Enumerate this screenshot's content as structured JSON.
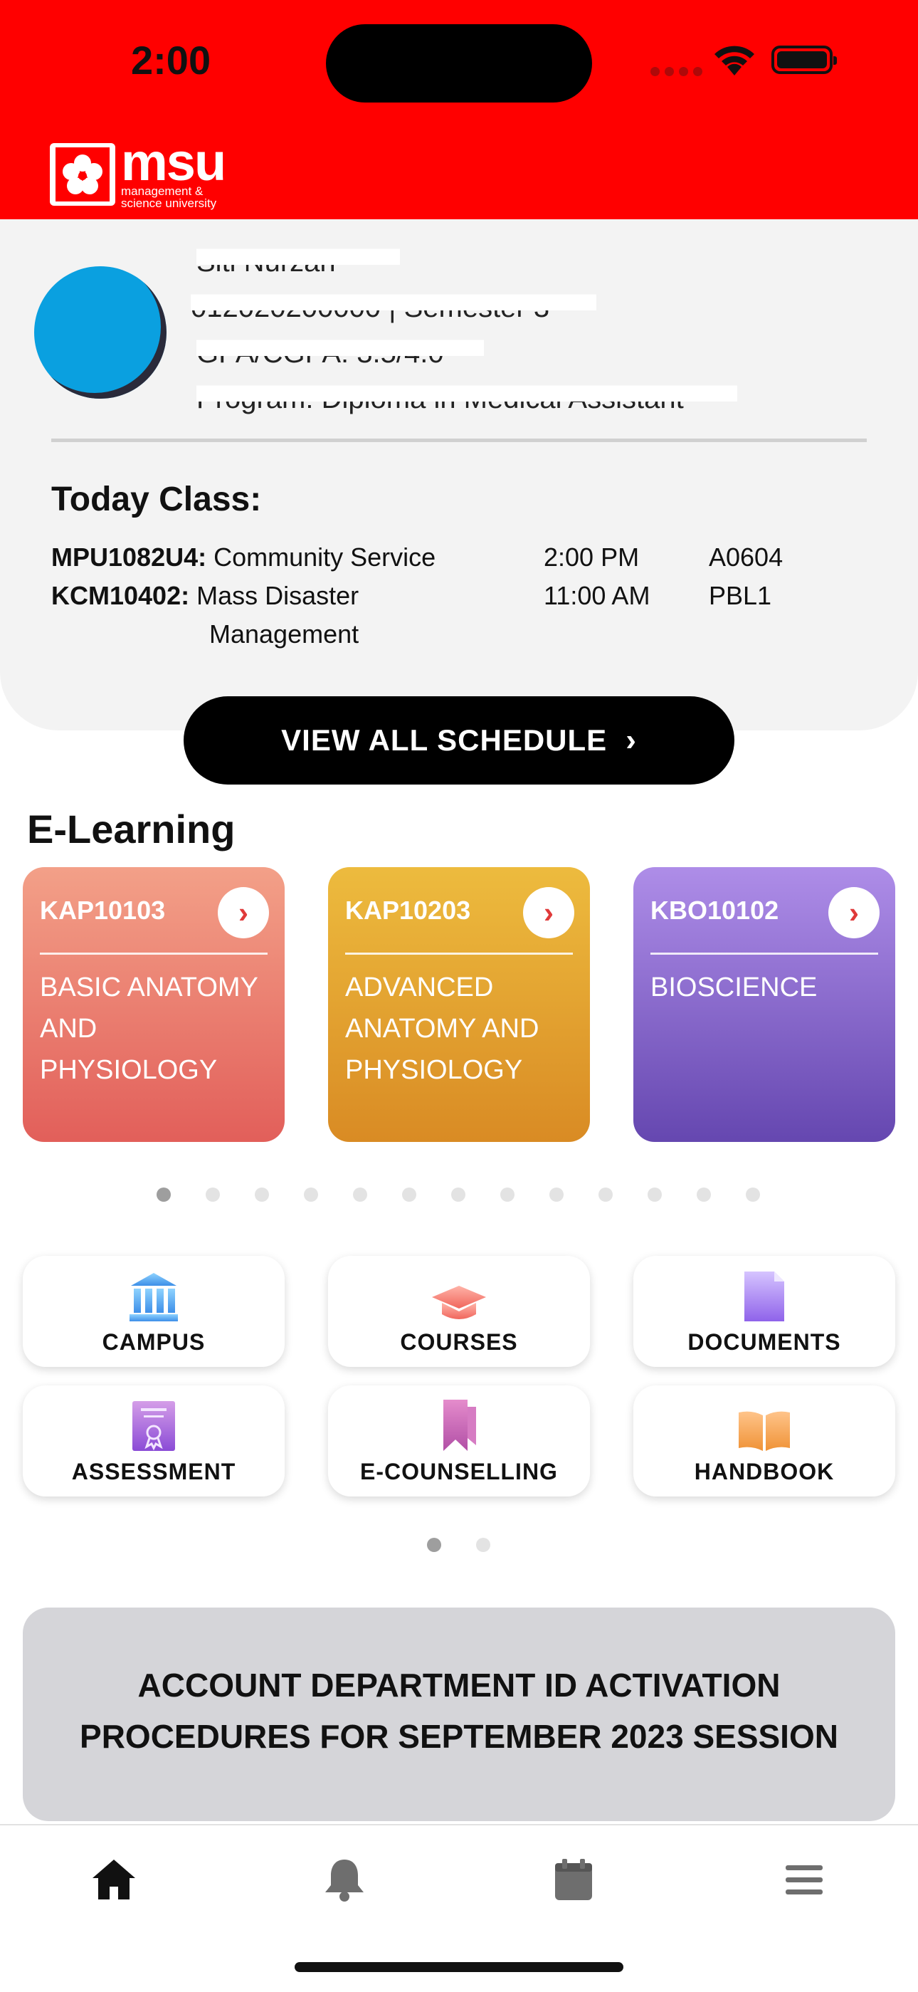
{
  "status_bar": {
    "time": "2:00"
  },
  "header": {
    "logo_name": "msu",
    "logo_sub_1": "management &",
    "logo_sub_2": "science university"
  },
  "profile": {
    "name": "Siti Nurzah",
    "id_semester": "012020200000 | Semester 3",
    "gpa_cgpa": "GPA/CGPA: 3.5/4.0",
    "program": "Program: Diploma in Medical Assistant"
  },
  "today_class": {
    "title": "Today Class:",
    "rows": [
      {
        "code": "MPU1082U4:",
        "subject": "Community Service",
        "time": "2:00 PM",
        "room": "A0604"
      },
      {
        "code": "KCM10402:",
        "subject_line1": "Mass Disaster",
        "subject_line2": "Management",
        "time": "11:00 AM",
        "room": "PBL1"
      }
    ]
  },
  "view_all": {
    "label": "VIEW ALL SCHEDULE"
  },
  "elearning": {
    "title": "E-Learning",
    "courses": [
      {
        "code": "KAP10103",
        "name_1": "BASIC ANATOMY",
        "name_2": "AND",
        "name_3": "PHYSIOLOGY"
      },
      {
        "code": "KAP10203",
        "name_1": "ADVANCED",
        "name_2": "ANATOMY AND",
        "name_3": "PHYSIOLOGY"
      },
      {
        "code": "KBO10102",
        "name_1": "BIOSCIENCE"
      }
    ],
    "page_count": 13,
    "active_page": 1
  },
  "quick_menu": {
    "items": [
      {
        "label": "CAMPUS",
        "icon": "campus-icon"
      },
      {
        "label": "COURSES",
        "icon": "graduation-cap-icon"
      },
      {
        "label": "DOCUMENTS",
        "icon": "document-icon"
      },
      {
        "label": "ASSESSMENT",
        "icon": "certificate-icon"
      },
      {
        "label": "E-COUNSELLING",
        "icon": "bookmark-icon"
      },
      {
        "label": "HANDBOOK",
        "icon": "open-book-icon"
      }
    ],
    "page_count": 2,
    "active_page": 1
  },
  "announcement": {
    "line1": "ACCOUNT DEPARTMENT ID ACTIVATION",
    "line2": "PROCEDURES FOR SEPTEMBER 2023 SESSION"
  },
  "tabbar": {
    "items": [
      {
        "icon": "home-icon",
        "active": true
      },
      {
        "icon": "bell-icon",
        "active": false
      },
      {
        "icon": "calendar-icon",
        "active": false
      },
      {
        "icon": "menu-icon",
        "active": false
      }
    ]
  },
  "colors": {
    "brand": "#ff0000",
    "card1": "#e25f5a",
    "card2": "#d98b24",
    "card3": "#6547b0"
  }
}
